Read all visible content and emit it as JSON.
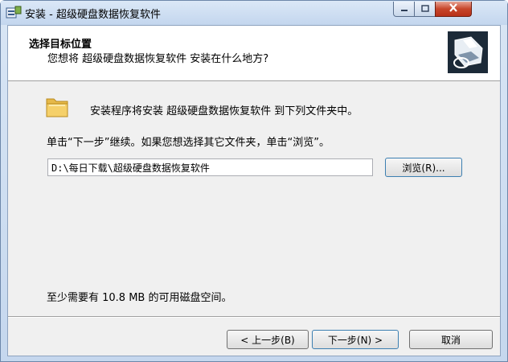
{
  "window": {
    "title": "安装 - 超级硬盘数据恢复软件"
  },
  "header": {
    "title": "选择目标位置",
    "subtitle": "您想将 超级硬盘数据恢复软件 安装在什么地方?"
  },
  "body": {
    "install_info": "安装程序将安装 超级硬盘数据恢复软件 到下列文件夹中。",
    "instruction": "单击“下一步”继续。如果您想选择其它文件夹，单击“浏览”。",
    "path_value": "D:\\每日下载\\超级硬盘数据恢复软件",
    "browse_label": "浏览(R)...",
    "space_required": "至少需要有 10.8 MB 的可用磁盘空间。"
  },
  "footer": {
    "back_label": "< 上一步(B)",
    "next_label": "下一步(N) >",
    "cancel_label": "取消"
  },
  "icons": {
    "title": "installer-icon",
    "header": "install-computer-icon",
    "folder": "folder-icon"
  }
}
